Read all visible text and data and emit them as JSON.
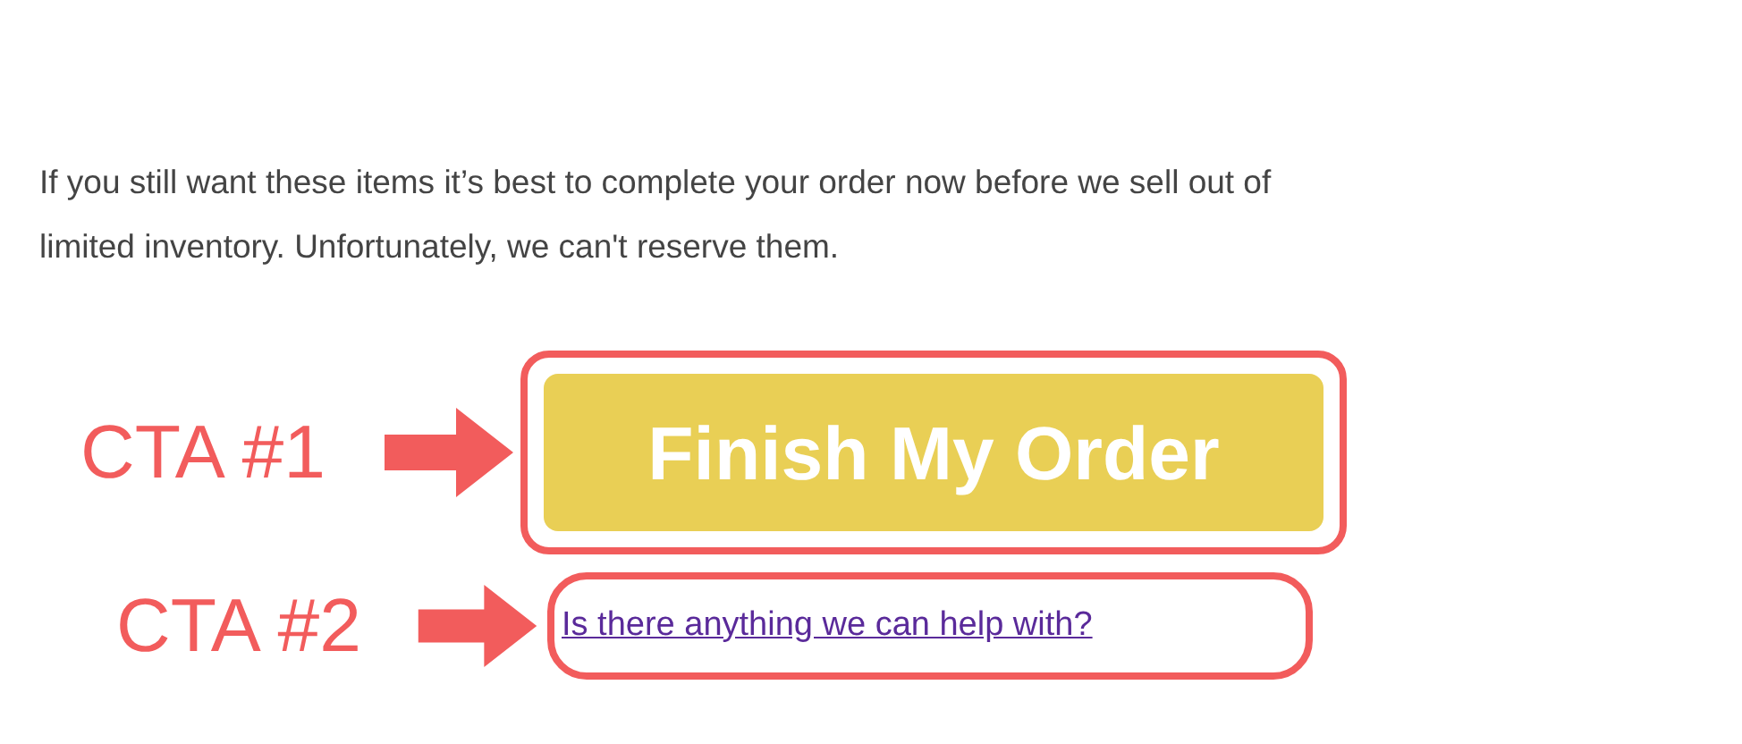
{
  "message": {
    "lines": [
      "If you still want these items it’s best to complete your order now before we sell out of",
      "limited inventory. Unfortunately, we can't reserve them."
    ]
  },
  "ctas": [
    {
      "kind": "button",
      "annotation": "CTA #1",
      "label": "Finish My Order"
    },
    {
      "kind": "link",
      "annotation": "CTA #2",
      "label": "Is there anything we can help with?"
    }
  ]
}
